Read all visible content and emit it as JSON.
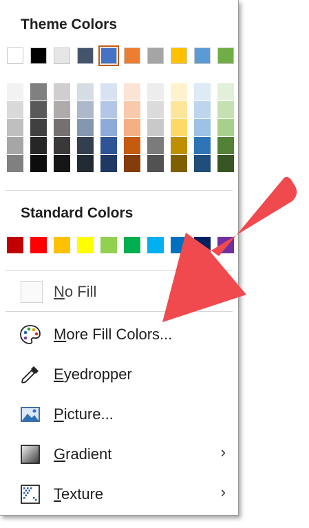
{
  "theme_colors": {
    "title": "Theme Colors",
    "top_row": [
      "#ffffff",
      "#000000",
      "#e7e6e6",
      "#44546a",
      "#4472c4",
      "#ed7d31",
      "#a5a5a5",
      "#ffc000",
      "#5b9bd5",
      "#70ad47"
    ],
    "selected_index": 4,
    "shades": [
      [
        "#f2f2f2",
        "#d9d9d9",
        "#bfbfbf",
        "#a6a6a6",
        "#808080"
      ],
      [
        "#808080",
        "#595959",
        "#404040",
        "#262626",
        "#0d0d0d"
      ],
      [
        "#d0cece",
        "#afabab",
        "#757171",
        "#3a3838",
        "#171616"
      ],
      [
        "#d6dce4",
        "#adb9ca",
        "#8497b0",
        "#333f4f",
        "#222a35"
      ],
      [
        "#d9e2f3",
        "#b4c6e7",
        "#8eaadb",
        "#2f5496",
        "#1f3864"
      ],
      [
        "#fbe4d5",
        "#f7caac",
        "#f4b083",
        "#c55a11",
        "#843c0b"
      ],
      [
        "#ededed",
        "#dbdbdb",
        "#c9c9c9",
        "#7b7b7b",
        "#525252"
      ],
      [
        "#fff2cc",
        "#fee599",
        "#ffd965",
        "#bf8f00",
        "#7f6000"
      ],
      [
        "#deeaf6",
        "#bdd6ee",
        "#9cc2e5",
        "#2e75b5",
        "#1e4e79"
      ],
      [
        "#e2efd9",
        "#c5e0b3",
        "#a8d08d",
        "#538135",
        "#375623"
      ]
    ]
  },
  "standard_colors": {
    "title": "Standard Colors",
    "colors": [
      "#c00000",
      "#ff0000",
      "#ffc000",
      "#ffff00",
      "#92d050",
      "#00b050",
      "#00b0f0",
      "#0070c0",
      "#002060",
      "#7030a0"
    ]
  },
  "items": {
    "no_fill": {
      "mnemonic": "N",
      "rest": "o Fill",
      "enabled": false
    },
    "more_fill_colors": {
      "mnemonic": "M",
      "rest": "ore Fill Colors...",
      "icon": "palette-icon"
    },
    "eyedropper": {
      "mnemonic": "E",
      "rest": "yedropper",
      "icon": "eyedropper-icon"
    },
    "picture": {
      "mnemonic": "P",
      "rest": "icture...",
      "icon": "picture-icon"
    },
    "gradient": {
      "mnemonic": "G",
      "rest": "radient",
      "icon": "gradient-icon",
      "submenu": true
    },
    "texture": {
      "mnemonic": "T",
      "rest": "exture",
      "icon": "texture-icon",
      "submenu": true
    }
  },
  "annotation_arrow_color": "#f04a4e"
}
